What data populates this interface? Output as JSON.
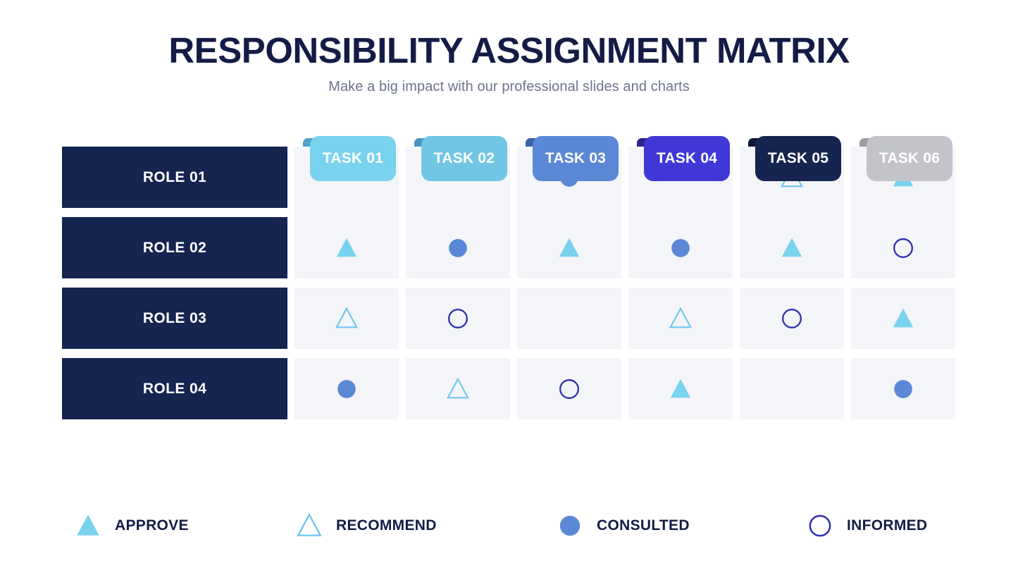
{
  "header": {
    "title": "RESPONSIBILITY ASSIGNMENT MATRIX",
    "subtitle": "Make a big impact with our professional slides and charts"
  },
  "colors": {
    "navy": "#152550",
    "title": "#141c46",
    "subtitle": "#6c738d",
    "cell_bg": "#f4f5f8",
    "approve": "#79d2ee",
    "recommend": "#6dc6ea",
    "consulted": "#5b88d6",
    "informed": "#2f2fb4"
  },
  "tasks": [
    {
      "label": "TASK 01",
      "color": "#79d2ee",
      "notch": "#4fa3c9"
    },
    {
      "label": "TASK 02",
      "color": "#71c6e4",
      "notch": "#4a97bd"
    },
    {
      "label": "TASK 03",
      "color": "#5b88d6",
      "notch": "#3a62ad"
    },
    {
      "label": "TASK 04",
      "color": "#4038d6",
      "notch": "#2b2596"
    },
    {
      "label": "TASK 05",
      "color": "#152550",
      "notch": "#0d1835"
    },
    {
      "label": "TASK 06",
      "color": "#c2c4c9",
      "notch": "#9b9da3"
    }
  ],
  "roles": [
    {
      "label": "ROLE 01"
    },
    {
      "label": "ROLE 02"
    },
    {
      "label": "ROLE 03"
    },
    {
      "label": "ROLE 04"
    }
  ],
  "legend": [
    {
      "key": "approve",
      "label": "APPROVE",
      "shape": "filled-triangle-icon"
    },
    {
      "key": "recommend",
      "label": "RECOMMEND",
      "shape": "outline-triangle-icon"
    },
    {
      "key": "consulted",
      "label": "CONSULTED",
      "shape": "filled-circle-icon"
    },
    {
      "key": "informed",
      "label": "INFORMED",
      "shape": "outline-circle-icon"
    }
  ],
  "matrix": [
    [
      "",
      "",
      "consulted",
      "",
      "recommend",
      "approve"
    ],
    [
      "approve",
      "consulted",
      "approve",
      "consulted",
      "approve",
      "informed"
    ],
    [
      "recommend",
      "informed",
      "",
      "recommend",
      "informed",
      "approve"
    ],
    [
      "consulted",
      "recommend",
      "informed",
      "approve",
      "",
      "consulted"
    ]
  ]
}
